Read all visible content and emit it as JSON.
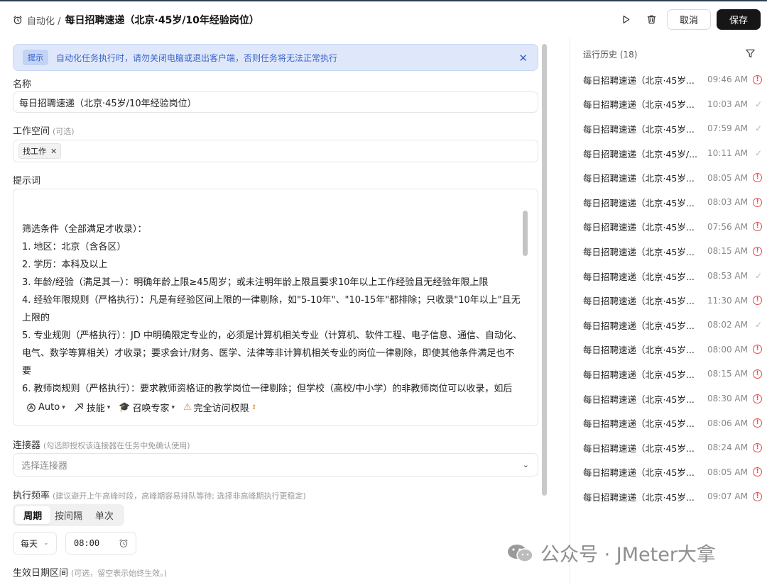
{
  "header": {
    "crumb": "自动化 /",
    "title": "每日招聘速递（北京·45岁/10年经验岗位）",
    "cancel": "取消",
    "save": "保存"
  },
  "notice": {
    "tag": "提示",
    "message": "自动化任务执行时，请勿关闭电脑或退出客户端，否则任务将无法正常执行"
  },
  "form": {
    "name_label": "名称",
    "name_value": "每日招聘速递（北京·45岁/10年经验岗位）",
    "workspace_label": "工作空间",
    "workspace_hint": "(可选)",
    "workspace_chip": "找工作",
    "prompt_label": "提示词",
    "prompt_text": "筛选条件（全部满足才收录）：\n1. 地区：北京（含各区）\n2. 学历：本科及以上\n3. 年龄/经验（满足其一）：明确年龄上限≥45周岁；或未注明年龄上限且要求10年以上工作经验且无经验年限上限\n4. 经验年限规则（严格执行）：凡是有经验区间上限的一律剔除，如\"5-10年\"、\"10-15年\"都排除；只收录\"10年以上\"且无上限的\n5. 专业规则（严格执行）：JD 中明确限定专业的，必须是计算机相关专业（计算机、软件工程、电子信息、通信、自动化、电气、数学等算相关）才收录；要求会计/财务、医学、法律等非计算机相关专业的岗位一律剔除，即使其他条件满足也不要\n6. 教师岗规则（严格执行）：要求教师资格证的教学岗位一律剔除；但学校（高校/中小学）的非教师岗位可以收录，如后",
    "tools": {
      "auto": "Auto",
      "skill": "技能",
      "expert": "召唤专家",
      "permission": "完全访问权限"
    },
    "connector_label": "连接器",
    "connector_hint": "(勾选即授权该连接器在任务中免确认使用)",
    "connector_placeholder": "选择连接器",
    "freq_label": "执行频率",
    "freq_hint": "(建议避开上午高峰时段，高峰期容易排队等待; 选择非高峰期执行更稳定)",
    "freq_tabs": [
      "周期",
      "按间隔",
      "单次"
    ],
    "freq_period": "每天",
    "freq_time": "08:00",
    "date_label": "生效日期区间",
    "date_hint": "(可选，留空表示始终生效。)"
  },
  "history": {
    "title": "运行历史 (18)",
    "items": [
      {
        "title": "每日招聘速递（北京·45岁...",
        "time": "09:46 AM",
        "status": "error"
      },
      {
        "title": "每日招聘速递（北京·45岁...",
        "time": "10:03 AM",
        "status": "ok"
      },
      {
        "title": "每日招聘速递（北京·45岁...",
        "time": "07:59 AM",
        "status": "ok"
      },
      {
        "title": "每日招聘速递（北京·45岁/...",
        "time": "10:11 AM",
        "status": "ok"
      },
      {
        "title": "每日招聘速递（北京·45岁...",
        "time": "08:05 AM",
        "status": "error"
      },
      {
        "title": "每日招聘速递（北京·45岁...",
        "time": "08:03 AM",
        "status": "error"
      },
      {
        "title": "每日招聘速递（北京·45岁...",
        "time": "07:56 AM",
        "status": "error"
      },
      {
        "title": "每日招聘速递（北京·45岁...",
        "time": "08:15 AM",
        "status": "error"
      },
      {
        "title": "每日招聘速递（北京·45岁...",
        "time": "08:53 AM",
        "status": "ok"
      },
      {
        "title": "每日招聘速递（北京·45岁...",
        "time": "11:30 AM",
        "status": "error"
      },
      {
        "title": "每日招聘速递（北京·45岁...",
        "time": "08:02 AM",
        "status": "ok"
      },
      {
        "title": "每日招聘速递（北京·45岁...",
        "time": "08:00 AM",
        "status": "error"
      },
      {
        "title": "每日招聘速递（北京·45岁...",
        "time": "08:15 AM",
        "status": "error"
      },
      {
        "title": "每日招聘速递（北京·45岁...",
        "time": "08:30 AM",
        "status": "error"
      },
      {
        "title": "每日招聘速递（北京·45岁...",
        "time": "08:06 AM",
        "status": "error"
      },
      {
        "title": "每日招聘速递（北京·45岁...",
        "time": "08:24 AM",
        "status": "error"
      },
      {
        "title": "每日招聘速递（北京·45岁...",
        "time": "08:05 AM",
        "status": "error"
      },
      {
        "title": "每日招聘速递（北京·45岁...",
        "time": "09:07 AM",
        "status": "error"
      }
    ]
  },
  "watermark": "公众号 · JMeter大拿",
  "colors": {
    "error": "#e5484d",
    "notice_bg": "#dfe8fb",
    "notice_text": "#3a64c8",
    "primary_button": "#161616"
  }
}
